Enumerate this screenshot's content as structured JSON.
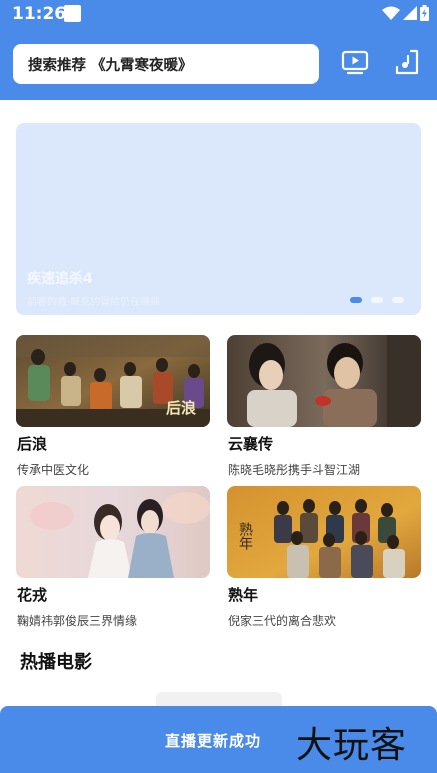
{
  "status_bar": {
    "time": "11:26"
  },
  "header": {
    "search_text": "搜索推荐 《九霄寒夜暖》"
  },
  "banner": {
    "title": "疾速追杀4",
    "subtitle": "前客的救·城克的冒险仍在继续",
    "dots": 3,
    "active_dot": 0
  },
  "grid": [
    {
      "title": "后浪",
      "desc": "传承中医文化",
      "poster_text": "后浪"
    },
    {
      "title": "云襄传",
      "desc": "陈晓毛晓彤携手斗智江湖",
      "poster_text": ""
    },
    {
      "title": "花戎",
      "desc": "鞠婧祎郭俊辰三界情缘",
      "poster_text": ""
    },
    {
      "title": "熟年",
      "desc": "倪家三代的离合悲欢",
      "poster_text": "熟年"
    }
  ],
  "section": {
    "title": "热播电影"
  },
  "bottom": {
    "message": "直播更新成功",
    "watermark": "大玩客"
  },
  "colors": {
    "accent": "#4a8bea",
    "banner_bg": "#dbe7fb"
  }
}
